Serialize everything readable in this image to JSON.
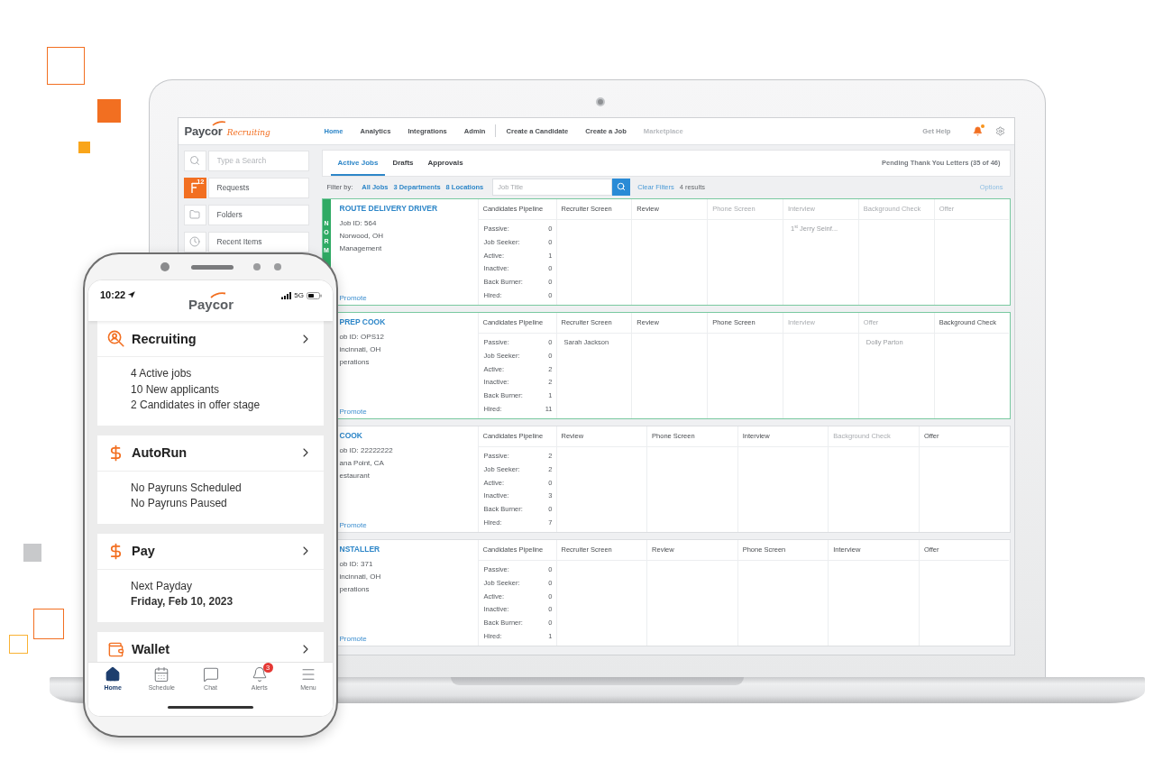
{
  "laptop": {
    "header": {
      "logo": {
        "brand": "Paycor",
        "product": "Recruiting"
      },
      "nav": [
        {
          "label": "Home",
          "selected": true
        },
        {
          "label": "Analytics",
          "selected": false
        },
        {
          "label": "Integrations",
          "selected": false
        },
        {
          "label": "Admin",
          "selected": false
        }
      ],
      "actions": [
        {
          "label": "Create a Candidate",
          "disabled": false
        },
        {
          "label": "Create a Job",
          "disabled": false
        },
        {
          "label": "Marketplace",
          "disabled": true
        }
      ],
      "help": "Get Help",
      "unread_alerts": true
    },
    "sidebar": {
      "search": {
        "placeholder": "Type a Search"
      },
      "items": [
        {
          "kind": "requests",
          "label": "Requests",
          "count": "12"
        },
        {
          "kind": "folders",
          "label": "Folders"
        },
        {
          "kind": "recent",
          "label": "Recent Items"
        }
      ]
    },
    "tabs": [
      {
        "label": "Active Jobs",
        "selected": true
      },
      {
        "label": "Drafts",
        "selected": false
      },
      {
        "label": "Approvals",
        "selected": false
      }
    ],
    "pending_letters": "Pending Thank You Letters (35 of 46)",
    "filters": {
      "label": "Filter by:",
      "links": [
        "All Jobs",
        "3 Departments",
        "8 Locations"
      ],
      "placeholder": "Job Title",
      "clear": "Clear Filters",
      "results": "4 results",
      "options": "Options"
    },
    "jobs": [
      {
        "title": "ROUTE DELIVERY DRIVER",
        "priority": "NORM",
        "selected": true,
        "details": [
          "Job ID: 564",
          "Norwood, OH",
          "Management"
        ],
        "promote": "Promote",
        "pipeline": {
          "title": "Candidates Pipeline",
          "rows": [
            {
              "label": "Passive:",
              "value": "0"
            },
            {
              "label": "Job Seeker:",
              "value": "0"
            },
            {
              "label": "Active:",
              "value": "1"
            },
            {
              "label": "Inactive:",
              "value": "0"
            },
            {
              "label": "Back Burner:",
              "value": "0"
            },
            {
              "label": "Hired:",
              "value": "0"
            }
          ]
        },
        "stages": [
          {
            "name": "Recruiter Screen",
            "muted": false
          },
          {
            "name": "Review",
            "muted": false
          },
          {
            "name": "Phone Screen",
            "muted": true
          },
          {
            "name": "Interview",
            "muted": true,
            "candidates": [
              "1$^{st}$ Jerry Seinf..."
            ]
          },
          {
            "name": "Background Check",
            "muted": true
          },
          {
            "name": "Offer",
            "muted": true
          }
        ]
      },
      {
        "title": "PREP COOK",
        "selected": true,
        "details": [
          "ob ID: OPS12",
          "incinnati, OH",
          "perations"
        ],
        "promote": "Promote",
        "pipeline": {
          "title": "Candidates Pipeline",
          "rows": [
            {
              "label": "Passive:",
              "value": "0"
            },
            {
              "label": "Job Seeker:",
              "value": "0"
            },
            {
              "label": "Active:",
              "value": "2"
            },
            {
              "label": "Inactive:",
              "value": "2"
            },
            {
              "label": "Back Burner:",
              "value": "1"
            },
            {
              "label": "Hired:",
              "value": "11"
            }
          ]
        },
        "stages": [
          {
            "name": "Recruiter Screen",
            "muted": false,
            "candidates": [
              "Sarah Jackson"
            ]
          },
          {
            "name": "Review",
            "muted": false
          },
          {
            "name": "Phone Screen",
            "muted": false
          },
          {
            "name": "Interview",
            "muted": true
          },
          {
            "name": "Offer",
            "muted": true,
            "candidates": [
              "Dolly Parton"
            ]
          },
          {
            "name": "Background Check",
            "muted": false
          }
        ]
      },
      {
        "title": "COOK",
        "selected": false,
        "details": [
          "ob ID: 22222222",
          "ana Point, CA",
          "estaurant"
        ],
        "promote": "Promote",
        "pipeline": {
          "title": "Candidates Pipeline",
          "rows": [
            {
              "label": "Passive:",
              "value": "2"
            },
            {
              "label": "Job Seeker:",
              "value": "2"
            },
            {
              "label": "Active:",
              "value": "0"
            },
            {
              "label": "Inactive:",
              "value": "3"
            },
            {
              "label": "Back Burner:",
              "value": "0"
            },
            {
              "label": "Hired:",
              "value": "7"
            }
          ]
        },
        "stages": [
          {
            "name": "Review",
            "muted": false
          },
          {
            "name": "Phone Screen",
            "muted": false
          },
          {
            "name": "Interview",
            "muted": false
          },
          {
            "name": "Background Check",
            "muted": true
          },
          {
            "name": "Offer",
            "muted": false
          }
        ]
      },
      {
        "title": "NSTALLER",
        "selected": false,
        "details": [
          "ob ID: 371",
          "incinnati, OH",
          "perations"
        ],
        "promote": "Promote",
        "pipeline": {
          "title": "Candidates Pipeline",
          "rows": [
            {
              "label": "Passive:",
              "value": "0"
            },
            {
              "label": "Job Seeker:",
              "value": "0"
            },
            {
              "label": "Active:",
              "value": "0"
            },
            {
              "label": "Inactive:",
              "value": "0"
            },
            {
              "label": "Back Burner:",
              "value": "0"
            },
            {
              "label": "Hired:",
              "value": "1"
            }
          ]
        },
        "stages": [
          {
            "name": "Recruiter Screen",
            "muted": false
          },
          {
            "name": "Review",
            "muted": false
          },
          {
            "name": "Phone Screen",
            "muted": false
          },
          {
            "name": "Interview",
            "muted": false
          },
          {
            "name": "Offer",
            "muted": false
          }
        ]
      }
    ]
  },
  "phone": {
    "status": {
      "time": "10:22",
      "network": "5G"
    },
    "logo": "Paycor",
    "cards": [
      {
        "kind": "recruiting",
        "title": "Recruiting",
        "lines": [
          {
            "text": "4 Active jobs",
            "bold": false
          },
          {
            "text": "10 New applicants",
            "bold": false
          },
          {
            "text": "2 Candidates in offer stage",
            "bold": false
          }
        ]
      },
      {
        "kind": "autorun",
        "title": "AutoRun",
        "lines": [
          {
            "text": "No Payruns Scheduled",
            "bold": false
          },
          {
            "text": "No Payruns Paused",
            "bold": false
          }
        ]
      },
      {
        "kind": "pay",
        "title": "Pay",
        "lines": [
          {
            "text": "Next Payday",
            "bold": false
          },
          {
            "text": "Friday, Feb 10, 2023",
            "bold": true
          }
        ]
      },
      {
        "kind": "wallet",
        "title": "Wallet"
      }
    ],
    "tabs": [
      {
        "kind": "home",
        "label": "Home",
        "selected": true
      },
      {
        "kind": "schedule",
        "label": "Schedule",
        "selected": false
      },
      {
        "kind": "chat",
        "label": "Chat",
        "selected": false
      },
      {
        "kind": "alerts",
        "label": "Alerts",
        "selected": false,
        "badge": "3"
      },
      {
        "kind": "menu",
        "label": "Menu",
        "selected": false
      }
    ]
  }
}
